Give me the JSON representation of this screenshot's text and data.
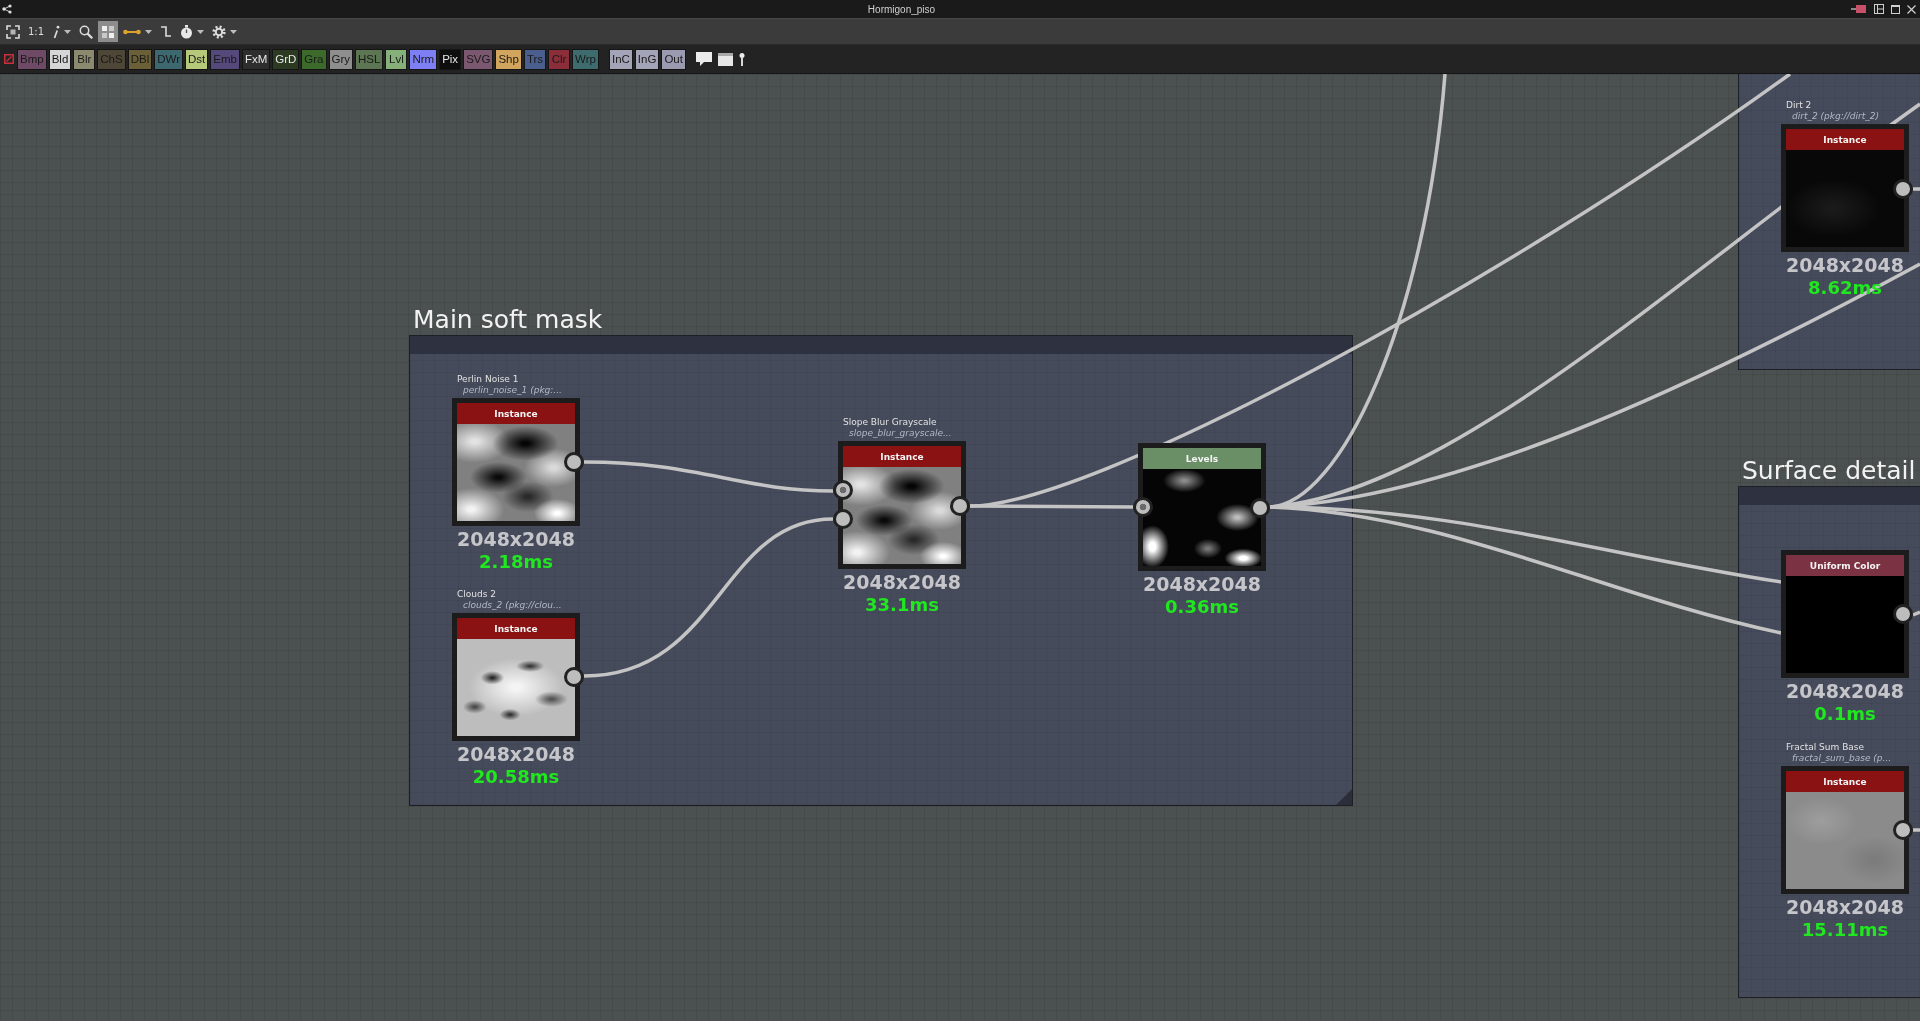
{
  "window": {
    "title": "Hormigon_piso"
  },
  "view_toolbar": {
    "tools": [
      {
        "kind": "icon",
        "selected": false,
        "menu": false
      },
      {
        "kind": "text",
        "label": "1:1",
        "selected": false,
        "menu": false
      },
      {
        "kind": "icon",
        "selected": false,
        "menu": true
      },
      {
        "kind": "icon",
        "selected": false,
        "menu": false
      },
      {
        "kind": "icon",
        "selected": true,
        "menu": false
      },
      {
        "kind": "icon",
        "selected": false,
        "menu": true
      },
      {
        "kind": "icon",
        "selected": false,
        "menu": false
      },
      {
        "kind": "icon",
        "selected": false,
        "menu": true
      },
      {
        "kind": "icon",
        "selected": false,
        "menu": true
      }
    ]
  },
  "filter_bar": {
    "node_filters": [
      {
        "label": "Bmp",
        "color": "#6e4a66"
      },
      {
        "label": "Bld",
        "color": "#d6d6d6"
      },
      {
        "label": "Blr",
        "color": "#8c8a6e"
      },
      {
        "label": "ChS",
        "color": "#4e4636"
      },
      {
        "label": "DBl",
        "color": "#6a5f36"
      },
      {
        "label": "DWr",
        "color": "#3d6870"
      },
      {
        "label": "Dst",
        "color": "#b6c97a"
      },
      {
        "label": "Emb",
        "color": "#55487a"
      },
      {
        "label": "FxM",
        "color": "#2e2e2e"
      },
      {
        "label": "GrD",
        "color": "#2c3a22"
      },
      {
        "label": "Gra",
        "color": "#3c6a2a"
      },
      {
        "label": "Gry",
        "color": "#8e8e8e"
      },
      {
        "label": "HSL",
        "color": "#5c7552"
      },
      {
        "label": "Lvl",
        "color": "#86b07a"
      },
      {
        "label": "Nrm",
        "color": "#7f7ff5"
      },
      {
        "label": "Pix",
        "color": "#0e0e0e"
      },
      {
        "label": "SVG",
        "color": "#7c5870"
      },
      {
        "label": "Shp",
        "color": "#d2a55e"
      },
      {
        "label": "Trs",
        "color": "#4b5f8e"
      },
      {
        "label": "Clr",
        "color": "#8c2e3a"
      },
      {
        "label": "Wrp",
        "color": "#3e6c6e"
      }
    ],
    "io_filters": [
      {
        "label": "InC",
        "color": "#a4a4b8"
      },
      {
        "label": "InG",
        "color": "#a4a4b8"
      },
      {
        "label": "Out",
        "color": "#9a9ab0"
      }
    ]
  },
  "graph": {
    "frames": [
      {
        "nodes": [
          {
            "label": "Dirt 2",
            "identifier": "dirt_2 (pkg://dirt_2)",
            "kind": "instance",
            "header": "Instance",
            "resolution": "2048x2048",
            "time": "8.62ms"
          }
        ]
      },
      {
        "title": "Main soft mask",
        "nodes": [
          {
            "label": "Perlin Noise 1",
            "identifier": "perlin_noise_1 (pkg:...",
            "kind": "instance",
            "header": "Instance",
            "resolution": "2048x2048",
            "time": "2.18ms"
          },
          {
            "label": "Clouds 2",
            "identifier": "clouds_2 (pkg://clou...",
            "kind": "instance",
            "header": "Instance",
            "resolution": "2048x2048",
            "time": "20.58ms"
          },
          {
            "label": "Slope Blur Grayscale",
            "identifier": "slope_blur_grayscale...",
            "kind": "instance",
            "header": "Instance",
            "inputs": [
              {
                "primary": true
              },
              {
                "primary": false
              }
            ],
            "resolution": "2048x2048",
            "time": "33.1ms"
          },
          {
            "kind": "levels",
            "header": "Levels",
            "inputs": [
              {
                "primary": true
              }
            ],
            "resolution": "2048x2048",
            "time": "0.36ms"
          }
        ]
      },
      {
        "title": "Surface detail",
        "nodes": [
          {
            "kind": "uniform_color",
            "header": "Uniform Color",
            "resolution": "2048x2048",
            "time": "0.1ms"
          },
          {
            "label": "Fractal Sum Base",
            "identifier": "fractal_sum_base (p...",
            "kind": "instance",
            "header": "Instance",
            "resolution": "2048x2048",
            "time": "15.11ms"
          }
        ]
      }
    ]
  }
}
